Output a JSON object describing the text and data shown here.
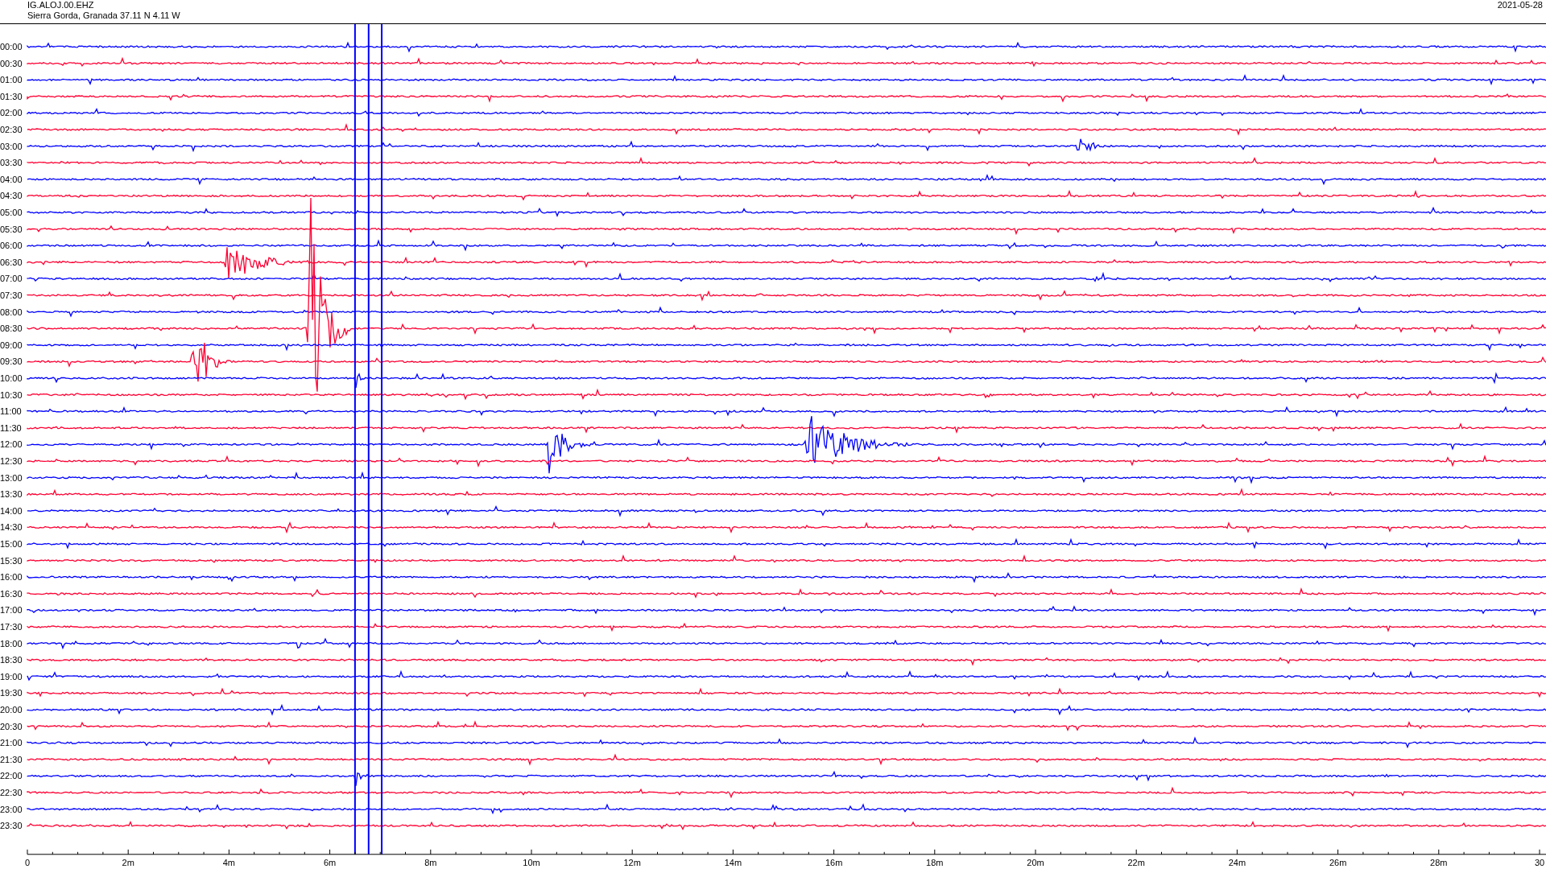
{
  "header": {
    "station": "IG.ALOJ.00.EHZ",
    "location": "Sierra Gorda, Granada  37.11 N 4.11 W",
    "date": "2021-05-28"
  },
  "rows": [
    {
      "label": "00:00",
      "color": "#0000ff"
    },
    {
      "label": "00:30",
      "color": "#ff0033"
    },
    {
      "label": "01:00",
      "color": "#0000ff"
    },
    {
      "label": "01:30",
      "color": "#ff0033"
    },
    {
      "label": "02:00",
      "color": "#0000ff"
    },
    {
      "label": "02:30",
      "color": "#ff0033"
    },
    {
      "label": "03:00",
      "color": "#0000ff"
    },
    {
      "label": "03:30",
      "color": "#ff0033"
    },
    {
      "label": "04:00",
      "color": "#0000ff"
    },
    {
      "label": "04:30",
      "color": "#ff0033"
    },
    {
      "label": "05:00",
      "color": "#0000ff"
    },
    {
      "label": "05:30",
      "color": "#ff0033"
    },
    {
      "label": "06:00",
      "color": "#0000ff"
    },
    {
      "label": "06:30",
      "color": "#ff0033"
    },
    {
      "label": "07:00",
      "color": "#0000ff"
    },
    {
      "label": "07:30",
      "color": "#ff0033"
    },
    {
      "label": "08:00",
      "color": "#0000ff"
    },
    {
      "label": "08:30",
      "color": "#ff0033"
    },
    {
      "label": "09:00",
      "color": "#0000ff"
    },
    {
      "label": "09:30",
      "color": "#ff0033"
    },
    {
      "label": "10:00",
      "color": "#0000ff"
    },
    {
      "label": "10:30",
      "color": "#ff0033"
    },
    {
      "label": "11:00",
      "color": "#0000ff"
    },
    {
      "label": "11:30",
      "color": "#ff0033"
    },
    {
      "label": "12:00",
      "color": "#0000ff"
    },
    {
      "label": "12:30",
      "color": "#ff0033"
    },
    {
      "label": "13:00",
      "color": "#0000ff"
    },
    {
      "label": "13:30",
      "color": "#ff0033"
    },
    {
      "label": "14:00",
      "color": "#0000ff"
    },
    {
      "label": "14:30",
      "color": "#ff0033"
    },
    {
      "label": "15:00",
      "color": "#0000ff"
    },
    {
      "label": "15:30",
      "color": "#ff0033"
    },
    {
      "label": "16:00",
      "color": "#0000ff"
    },
    {
      "label": "16:30",
      "color": "#ff0033"
    },
    {
      "label": "17:00",
      "color": "#0000ff"
    },
    {
      "label": "17:30",
      "color": "#ff0033"
    },
    {
      "label": "18:00",
      "color": "#0000ff"
    },
    {
      "label": "18:30",
      "color": "#ff0033"
    },
    {
      "label": "19:00",
      "color": "#0000ff"
    },
    {
      "label": "19:30",
      "color": "#ff0033"
    },
    {
      "label": "20:00",
      "color": "#0000ff"
    },
    {
      "label": "20:30",
      "color": "#ff0033"
    },
    {
      "label": "21:00",
      "color": "#0000ff"
    },
    {
      "label": "21:30",
      "color": "#ff0033"
    },
    {
      "label": "22:00",
      "color": "#0000ff"
    },
    {
      "label": "22:30",
      "color": "#ff0033"
    },
    {
      "label": "23:00",
      "color": "#0000ff"
    },
    {
      "label": "23:30",
      "color": "#ff0033"
    }
  ],
  "x_axis": {
    "labels": [
      "0",
      "2m",
      "4m",
      "6m",
      "8m",
      "10m",
      "12m",
      "14m",
      "16m",
      "18m",
      "20m",
      "22m",
      "24m",
      "26m",
      "28m",
      "30"
    ]
  }
}
